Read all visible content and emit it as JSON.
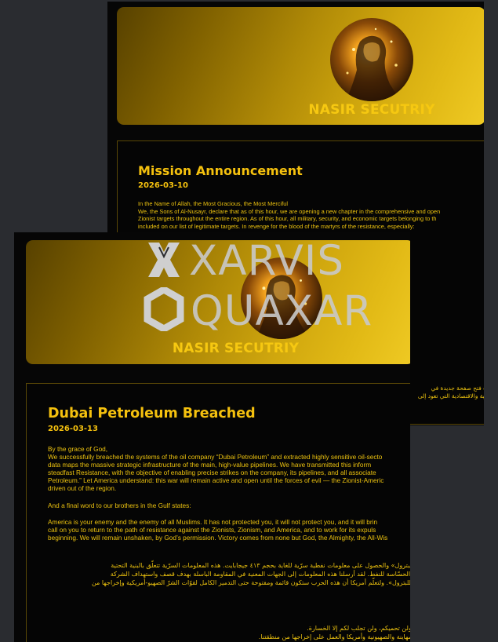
{
  "back_window": {
    "banner_title": "NASIR SECUTRIY",
    "post": {
      "title": "Mission Announcement",
      "date": "2026-03-10",
      "lines": [
        "In the Name of Allah, the Most Gracious, the Most Merciful",
        "We, the Sons of Al-Nusayr, declare that as of this hour, we are opening a new chapter in the comprehensive and open",
        "Zionist targets throughout the entire region. As of this hour, all military, security, and economic targets belonging to th",
        "included on our list of legitimate targets. In revenge for the blood of the martyrs of the resistance, especially:"
      ],
      "arabic_lines": [
        "ة فتح صفحة جديدة في",
        "نية والاقتصادية التي تعود إلى"
      ]
    }
  },
  "front_window": {
    "banner_title": "NASIR SECUTRIY",
    "post": {
      "title": "Dubai Petroleum Breached",
      "date": "2026-03-13",
      "paragraph1": [
        "By the grace of God,",
        "We successfully breached the systems of the oil company “Dubai Petroleum” and extracted highly sensitive oil-secto",
        "data maps the massive strategic infrastructure of the main, high-value pipelines. We have transmitted this inform",
        "steadfast Resistance, with the objective of enabling precise strikes on the company, its pipelines, and all associate",
        "Petroleum.” Let America understand: this war will remain active and open until the forces of evil — the Zionist-Americ",
        "driven out of the region."
      ],
      "paragraph2": "And a final word to our brothers in the Gulf states:",
      "paragraph3": [
        "America is your enemy and the enemy of all Muslims. It has not protected you, it will not protect you, and it will brin",
        "call on you to return to the path of resistance against the Zionists, Zionism, and America, and to work for its expuls",
        "beginning. We will remain unshaken, by God’s permission. Victory comes from none but God, the Almighty, the All-Wis"
      ],
      "arabic_para1": [
        "بي للبترول» والحصول على معلومات نفطية سرّية للغاية بحجم ٤١٣ جيجابايت. هذه المعلومات السرّية تتعلّق بالبنية التحتية",
        "سية الحسّاسة للنفط. لقد أرسلنا هذه المعلومات إلى الجهات المعنية في المقاومة الباسلة بهدف قصف واستهداف الشركة",
        "دبي للبترول». ولتعلّم أمريكا أن هذه الحرب ستكون قائمة ومفتوحة حتى التدمير الكامل لقوّات الشرّ الصهيو-أمريكية وإخراجها من"
      ],
      "arabic_heading": "ج:",
      "arabic_para2": [
        "ولم ولن تحميكم، ولن تجلب لكم إلا الخسارة.",
        "ة الصهاينة والصهيونية وأمريكا والعمل على إخراجها من منطقتنا."
      ]
    }
  },
  "watermark": {
    "line1": "XARVIS",
    "line2": "QUAXAR"
  }
}
